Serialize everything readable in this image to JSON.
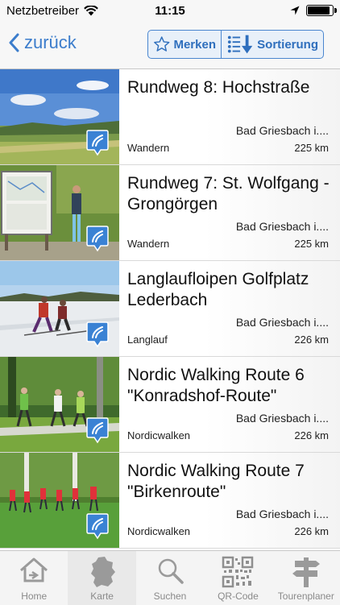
{
  "status_bar": {
    "carrier": "Netzbetreiber",
    "time": "11:15",
    "battery_level": 0.9
  },
  "nav": {
    "back_label": "zurück",
    "merken_label": "Merken",
    "sort_label": "Sortierung"
  },
  "items": [
    {
      "title": "Rundweg 8: Hochstraße",
      "location": "Bad Griesbach i....",
      "activity": "Wandern",
      "distance": "225 km"
    },
    {
      "title": "Rundweg 7: St. Wolfgang - Grongörgen",
      "location": "Bad Griesbach i....",
      "activity": "Wandern",
      "distance": "225 km"
    },
    {
      "title": "Langlaufloipen Golfplatz Lederbach",
      "location": "Bad Griesbach i....",
      "activity": "Langlauf",
      "distance": "226 km"
    },
    {
      "title": "Nordic Walking Route 6 \"Konradshof-Route\"",
      "location": "Bad Griesbach i....",
      "activity": "Nordicwalken",
      "distance": "226 km"
    },
    {
      "title": "Nordic Walking Route 7 \"Birkenroute\"",
      "location": "Bad Griesbach i....",
      "activity": "Nordicwalken",
      "distance": "226 km"
    }
  ],
  "tabs": [
    {
      "label": "Home",
      "icon": "home-icon"
    },
    {
      "label": "Karte",
      "icon": "map-germany-icon"
    },
    {
      "label": "Suchen",
      "icon": "search-icon"
    },
    {
      "label": "QR-Code",
      "icon": "qr-code-icon"
    },
    {
      "label": "Tourenplaner",
      "icon": "signpost-icon"
    }
  ],
  "colors": {
    "accent": "#3c7dcc",
    "badge": "#3a82d4",
    "tab_inactive": "#8a8a8a"
  }
}
